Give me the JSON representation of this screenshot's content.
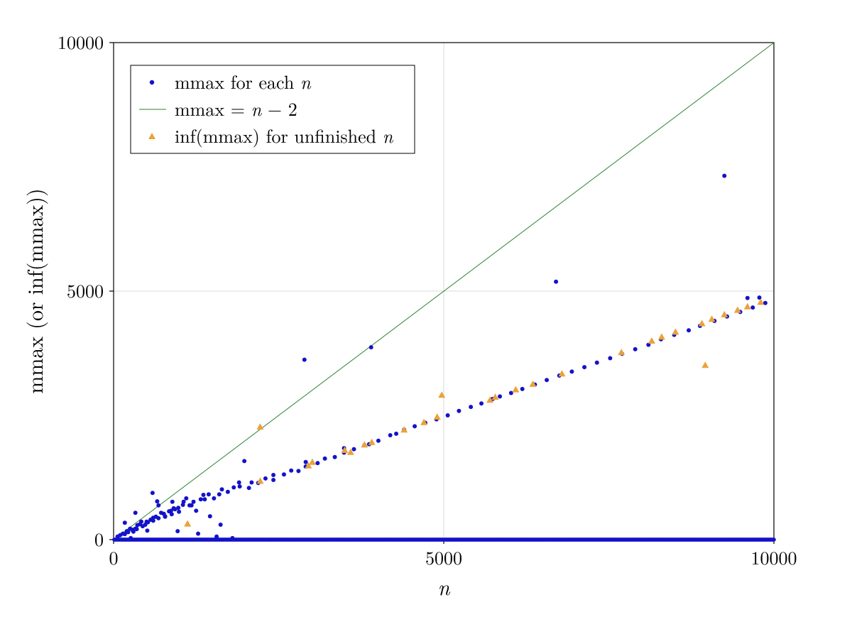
{
  "chart_data": {
    "type": "scatter",
    "xlabel": "n",
    "ylabel": "mmax (or inf(mmax))",
    "xlim": [
      0,
      10000
    ],
    "ylim": [
      0,
      10000
    ],
    "xticks": [
      0,
      5000,
      10000
    ],
    "yticks": [
      0,
      5000,
      10000
    ],
    "legend_position": "top-left",
    "series": [
      {
        "name": "mmax for each n",
        "type": "scatter",
        "marker": "dot",
        "color": "#1412c9",
        "x": [
          60,
          100,
          140,
          170,
          200,
          220,
          250,
          280,
          300,
          330,
          360,
          400,
          440,
          480,
          520,
          560,
          600,
          640,
          680,
          720,
          780,
          840,
          880,
          930,
          990,
          1050,
          1060,
          1150,
          1210,
          1320,
          1380,
          1440,
          1520,
          1600,
          1640,
          1730,
          1820,
          1910,
          1900,
          2050,
          2090,
          2190,
          2300,
          2420,
          2420,
          2580,
          2690,
          2800,
          2910,
          2910,
          3090,
          3200,
          3350,
          3490,
          3490,
          3640,
          3800,
          3870,
          4010,
          4190,
          4280,
          4400,
          4560,
          4720,
          4890,
          5060,
          5230,
          5410,
          5570,
          5740,
          5850,
          6020,
          6190,
          6380,
          6560,
          6750,
          6940,
          7130,
          7320,
          7520,
          7700,
          7900,
          8100,
          8290,
          8490,
          8710,
          8880,
          9100,
          9290,
          9490,
          9680,
          9870,
          9780,
          9600,
          1980,
          6700,
          2890,
          3900,
          9250,
          260,
          510,
          350,
          170,
          420,
          600,
          760,
          870,
          500,
          680,
          330,
          890,
          910,
          780,
          1100,
          660,
          1360,
          1180,
          590,
          980,
          1250,
          1460,
          1620,
          970,
          1280,
          1560,
          1800
        ],
        "y": [
          60,
          90,
          120,
          110,
          170,
          150,
          220,
          200,
          160,
          220,
          290,
          310,
          270,
          300,
          350,
          400,
          380,
          460,
          430,
          540,
          460,
          570,
          510,
          610,
          560,
          700,
          760,
          690,
          760,
          810,
          810,
          910,
          830,
          910,
          1010,
          960,
          1050,
          1070,
          1150,
          1040,
          1150,
          1140,
          1230,
          1200,
          1300,
          1310,
          1390,
          1380,
          1470,
          1560,
          1540,
          1630,
          1660,
          1750,
          1840,
          1820,
          1900,
          1920,
          1990,
          2100,
          2130,
          2210,
          2280,
          2350,
          2420,
          2500,
          2590,
          2670,
          2740,
          2830,
          2880,
          2950,
          3030,
          3120,
          3210,
          3300,
          3380,
          3470,
          3560,
          3650,
          3740,
          3830,
          3920,
          4030,
          4120,
          4210,
          4300,
          4400,
          4490,
          4580,
          4670,
          4760,
          4870,
          4860,
          1580,
          5190,
          3620,
          3870,
          7320,
          30,
          180,
          210,
          340,
          360,
          440,
          520,
          580,
          360,
          690,
          540,
          760,
          630,
          470,
          830,
          770,
          900,
          690,
          940,
          640,
          580,
          470,
          300,
          170,
          120,
          60,
          30
        ],
        "note": "Representative subset of the visible dots; true plot contains ~10000 points along two visible trends (y≈0 dense band and y≈0.5x sparse band)."
      },
      {
        "name": "mmax = n − 2",
        "type": "line",
        "color": "#2f8132",
        "x": [
          2,
          10000
        ],
        "y": [
          0,
          9998
        ]
      },
      {
        "name": "inf(mmax) for unfinished n",
        "type": "scatter",
        "marker": "triangle",
        "color": "#e9a23b",
        "x": [
          1120,
          2220,
          2220,
          2950,
          3010,
          3500,
          3590,
          3800,
          3910,
          4400,
          4700,
          4900,
          4970,
          5700,
          5780,
          6090,
          6350,
          6790,
          7690,
          8150,
          8300,
          8510,
          8910,
          8960,
          9060,
          9250,
          9450,
          9600,
          9800
        ],
        "y": [
          320,
          2270,
          1180,
          1490,
          1560,
          1800,
          1760,
          1910,
          1960,
          2210,
          2360,
          2470,
          2910,
          2810,
          2870,
          3020,
          3130,
          3340,
          3770,
          4000,
          4080,
          4180,
          4350,
          3510,
          4440,
          4530,
          4620,
          4690,
          4780
        ]
      }
    ],
    "legend": [
      "mmax for each n",
      "mmax = n − 2",
      "inf(mmax) for unfinished n"
    ],
    "dense_zero_band": {
      "description": "Blue dots densely cover y≈0 for all n in [0,10000]",
      "x_range": [
        0,
        10000
      ],
      "y_approx": 0
    }
  }
}
